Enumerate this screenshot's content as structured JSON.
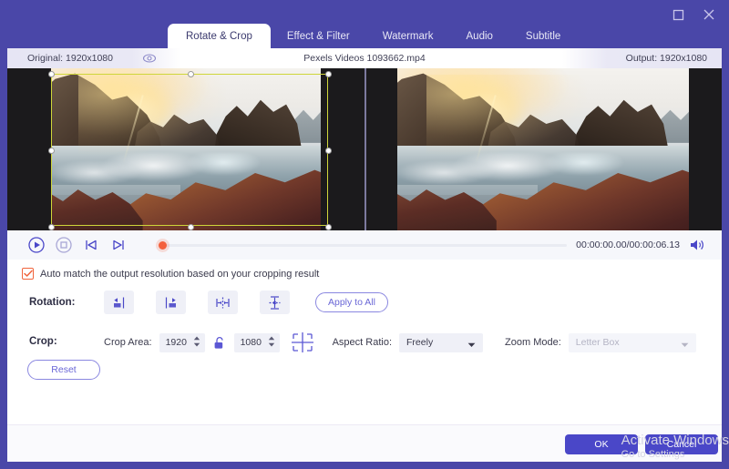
{
  "window": {
    "maximize_icon": "maximize-icon",
    "close_icon": "close-icon"
  },
  "tabs": [
    {
      "label": "Rotate & Crop",
      "active": true
    },
    {
      "label": "Effect & Filter",
      "active": false
    },
    {
      "label": "Watermark",
      "active": false
    },
    {
      "label": "Audio",
      "active": false
    },
    {
      "label": "Subtitle",
      "active": false
    }
  ],
  "info": {
    "original": "Original: 1920x1080",
    "eye_icon": "eye-icon",
    "filename": "Pexels Videos 1093662.mp4",
    "output": "Output: 1920x1080"
  },
  "player": {
    "play_icon": "play-icon",
    "stop_icon": "stop-icon",
    "prev_icon": "previous-frame-icon",
    "next_icon": "next-frame-icon",
    "timecode": "00:00:00.00/00:00:06.13",
    "volume_icon": "volume-icon"
  },
  "options": {
    "auto_match_label": "Auto match the output resolution based on your cropping result",
    "auto_match_checked": true
  },
  "rotation": {
    "label": "Rotation:",
    "buttons": [
      {
        "name": "rotate-left-button"
      },
      {
        "name": "rotate-right-button"
      },
      {
        "name": "flip-horizontal-button"
      },
      {
        "name": "flip-vertical-button"
      }
    ],
    "apply_to_all": "Apply to All"
  },
  "crop": {
    "label": "Crop:",
    "area_label": "Crop Area:",
    "width": "1920",
    "height": "1080",
    "lock_icon": "unlock-icon",
    "center_icon": "crop-center-icon",
    "aspect_label": "Aspect Ratio:",
    "aspect_value": "Freely",
    "zoom_label": "Zoom Mode:",
    "zoom_value": "Letter Box",
    "zoom_disabled": true,
    "reset": "Reset"
  },
  "footer": {
    "ok": "OK",
    "cancel": "Cancel"
  },
  "watermark": {
    "line1": "Activate Windows",
    "line2": "Go to Settings"
  },
  "colors": {
    "brand_purple": "#4a47a8",
    "accent_blue": "#4a47c8",
    "crop_border": "#cfd63a",
    "checkbox_orange": "#f0643c",
    "playhead": "#f4603c"
  }
}
